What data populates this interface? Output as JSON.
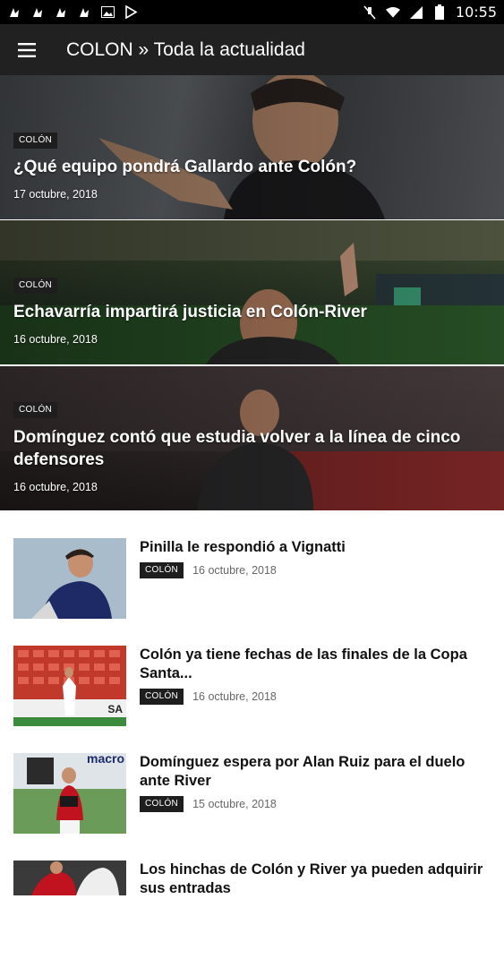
{
  "status_bar": {
    "time": "10:55",
    "left_icons": [
      "notification-icon",
      "notification-icon",
      "notification-icon",
      "notification-icon",
      "image-icon",
      "play-store-icon"
    ],
    "right_icons": [
      "mute-icon",
      "wifi-icon",
      "signal-icon",
      "battery-icon"
    ]
  },
  "app_bar": {
    "title": "COLON » Toda la actualidad"
  },
  "featured": [
    {
      "tag": "COLÓN",
      "title": "¿Qué equipo pondrá Gallardo ante Colón?",
      "date": "17 octubre, 2018"
    },
    {
      "tag": "COLÓN",
      "title": "Echavarría impartirá justicia en Colón-River",
      "date": "16 octubre, 2018"
    },
    {
      "tag": "COLÓN",
      "title": "Domínguez contó que estudia volver a la línea de cinco defensores",
      "date": "16 octubre, 2018"
    }
  ],
  "articles": [
    {
      "title": "Pinilla le respondió a Vignatti",
      "tag": "COLÓN",
      "date": "16 octubre, 2018"
    },
    {
      "title": "Colón ya tiene fechas de las finales de la Copa Santa...",
      "tag": "COLÓN",
      "date": "16 octubre, 2018"
    },
    {
      "title": "Domínguez espera por Alan Ruiz para el duelo ante River",
      "tag": "COLÓN",
      "date": "15 octubre, 2018"
    },
    {
      "title": "Los hinchas de Colón y River ya pueden adquirir sus entradas",
      "tag": "",
      "date": ""
    }
  ],
  "thumb_text": {
    "t2_ad": "SA",
    "t3_ad": "macro"
  },
  "colors": {
    "status_bar": "#000000",
    "app_bar": "#212121",
    "tag_bg": "#1e1e1e"
  }
}
